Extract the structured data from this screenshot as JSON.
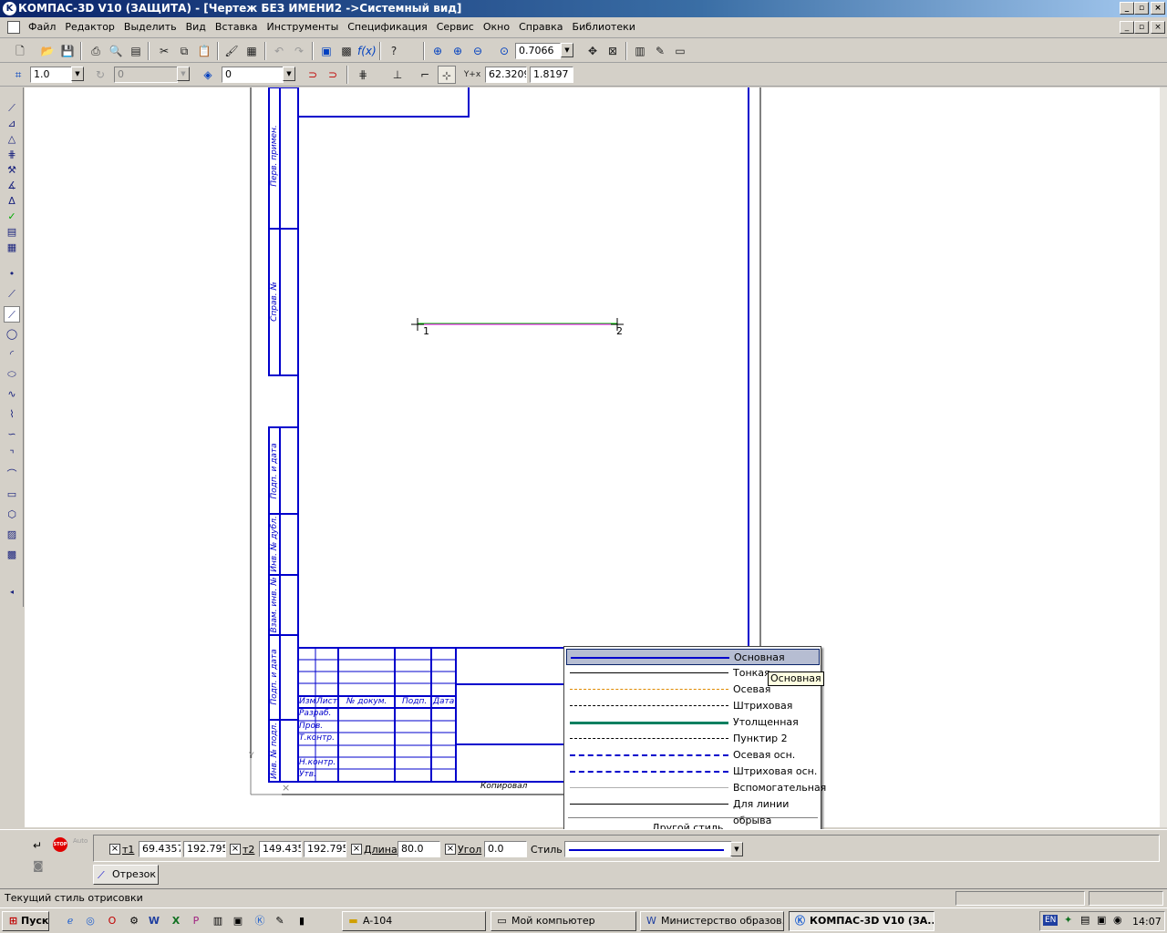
{
  "window": {
    "title": "КОМПАС-3D V10 (ЗАЩИТА) - [Чертеж БЕЗ ИМЕНИ2 ->Системный вид]"
  },
  "menu": [
    "Файл",
    "Редактор",
    "Выделить",
    "Вид",
    "Вставка",
    "Инструменты",
    "Спецификация",
    "Сервис",
    "Окно",
    "Справка",
    "Библиотеки"
  ],
  "toolbar": {
    "zoom_value": "0.7066"
  },
  "toolbar2": {
    "step_value": "1.0",
    "angle_value": "0",
    "layer_value": "0",
    "cursor_x": "62.3209",
    "cursor_y": "1.8197"
  },
  "drawing": {
    "stamp_labels": [
      "Перв. примен.",
      "Справ. №",
      "Подп. и дата",
      "Инв. № дубл.",
      "Взам. инв. №",
      "Подп. и дата",
      "Инв. № подл."
    ],
    "title_block_headers": [
      "Изм",
      "Лист",
      "№ докум.",
      "Подп.",
      "Дата"
    ],
    "title_block_rows": [
      "Разраб.",
      "Пров.",
      "Т.контр.",
      "Н.контр.",
      "Утв."
    ],
    "copied_label": "Копировал",
    "point1": "1",
    "point2": "2"
  },
  "style_dropdown": {
    "items": [
      {
        "name": "Основная",
        "color": "#0000cc",
        "style": "solid",
        "width": 2
      },
      {
        "name": "Тонкая",
        "color": "#000000",
        "style": "solid",
        "width": 1
      },
      {
        "name": "Осевая",
        "color": "#e08a00",
        "style": "dashdot",
        "width": 1
      },
      {
        "name": "Штриховая",
        "color": "#000000",
        "style": "dashed",
        "width": 1
      },
      {
        "name": "Утолщенная",
        "color": "#008060",
        "style": "solid",
        "width": 3
      },
      {
        "name": "Пунктир 2",
        "color": "#000000",
        "style": "dashdot",
        "width": 1
      },
      {
        "name": "Осевая осн.",
        "color": "#0000cc",
        "style": "dashdot",
        "width": 2
      },
      {
        "name": "Штриховая осн.",
        "color": "#0000cc",
        "style": "dashed",
        "width": 2
      },
      {
        "name": "Вспомогательная",
        "color": "#b0b0b0",
        "style": "solid",
        "width": 1
      },
      {
        "name": "Для линии обрыва",
        "color": "#000000",
        "style": "solid",
        "width": 1
      }
    ],
    "other_label": "Другой стиль...",
    "tooltip": "Основная"
  },
  "properties": {
    "t1_label": "т1",
    "t1_x": "69.4357",
    "t1_y": "192.795",
    "t2_label": "т2",
    "t2_x": "149.435",
    "t2_y": "192.795",
    "length_label": "Длина",
    "length_value": "80.0",
    "angle_label": "Угол",
    "angle_value": "0.0",
    "style_label": "Стиль",
    "tab_label": "Отрезок",
    "auto_label": "Auto",
    "stop_label": "STOP"
  },
  "status": {
    "text": "Текущий стиль отрисовки"
  },
  "taskbar": {
    "start": "Пуск",
    "buttons": [
      "A-104",
      "Мой компьютер",
      "Министерство образов...",
      "КОМПАС-3D V10 (ЗА..."
    ],
    "lang": "EN",
    "clock": "14:07"
  }
}
